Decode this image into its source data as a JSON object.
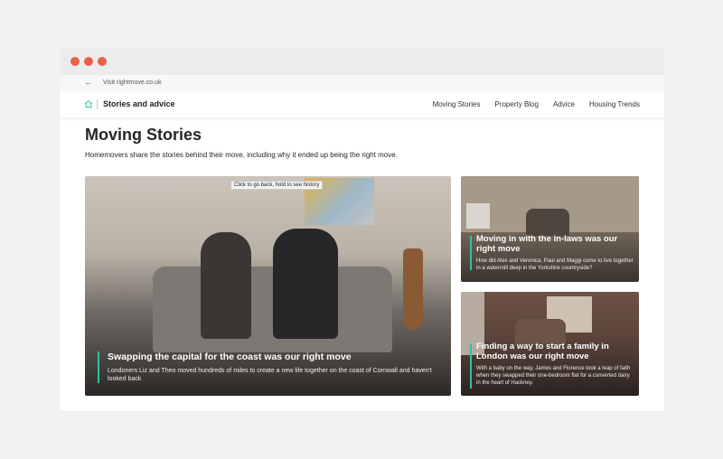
{
  "browser": {
    "window_dots": [
      "close",
      "minimize",
      "maximize"
    ]
  },
  "visit_bar": {
    "back_icon": "←",
    "text": "Visit rightmove.co.uk"
  },
  "nav": {
    "brand": "Stories and advice",
    "links": [
      "Moving Stories",
      "Property Blog",
      "Advice",
      "Housing Trends"
    ]
  },
  "page": {
    "title": "Moving Stories",
    "subtitle": "Homemovers share the stories behind their move, including why it ended up being the right move."
  },
  "tooltip": "Click to go back, hold to see history",
  "stories": [
    {
      "title": "Swapping the capital for the coast was our right move",
      "description": "Londoners Liz and Theo moved hundreds of miles to create a new life together on the coast of Cornwall and haven't looked back"
    },
    {
      "title": "Moving in with the in-laws was our right move",
      "description": "How did Alex and Veronica, Paul and Maggi come to live together in a watermill deep in the Yorkshire countryside?"
    },
    {
      "title": "Finding a way to start a family in London was our right move",
      "description": "With a baby on the way, James and Florence took a leap of faith when they swapped their one-bedroom flat for a converted dairy in the heart of Hackney."
    }
  ],
  "colors": {
    "accent": "#2ec4a0",
    "dots": "#e8624a"
  }
}
